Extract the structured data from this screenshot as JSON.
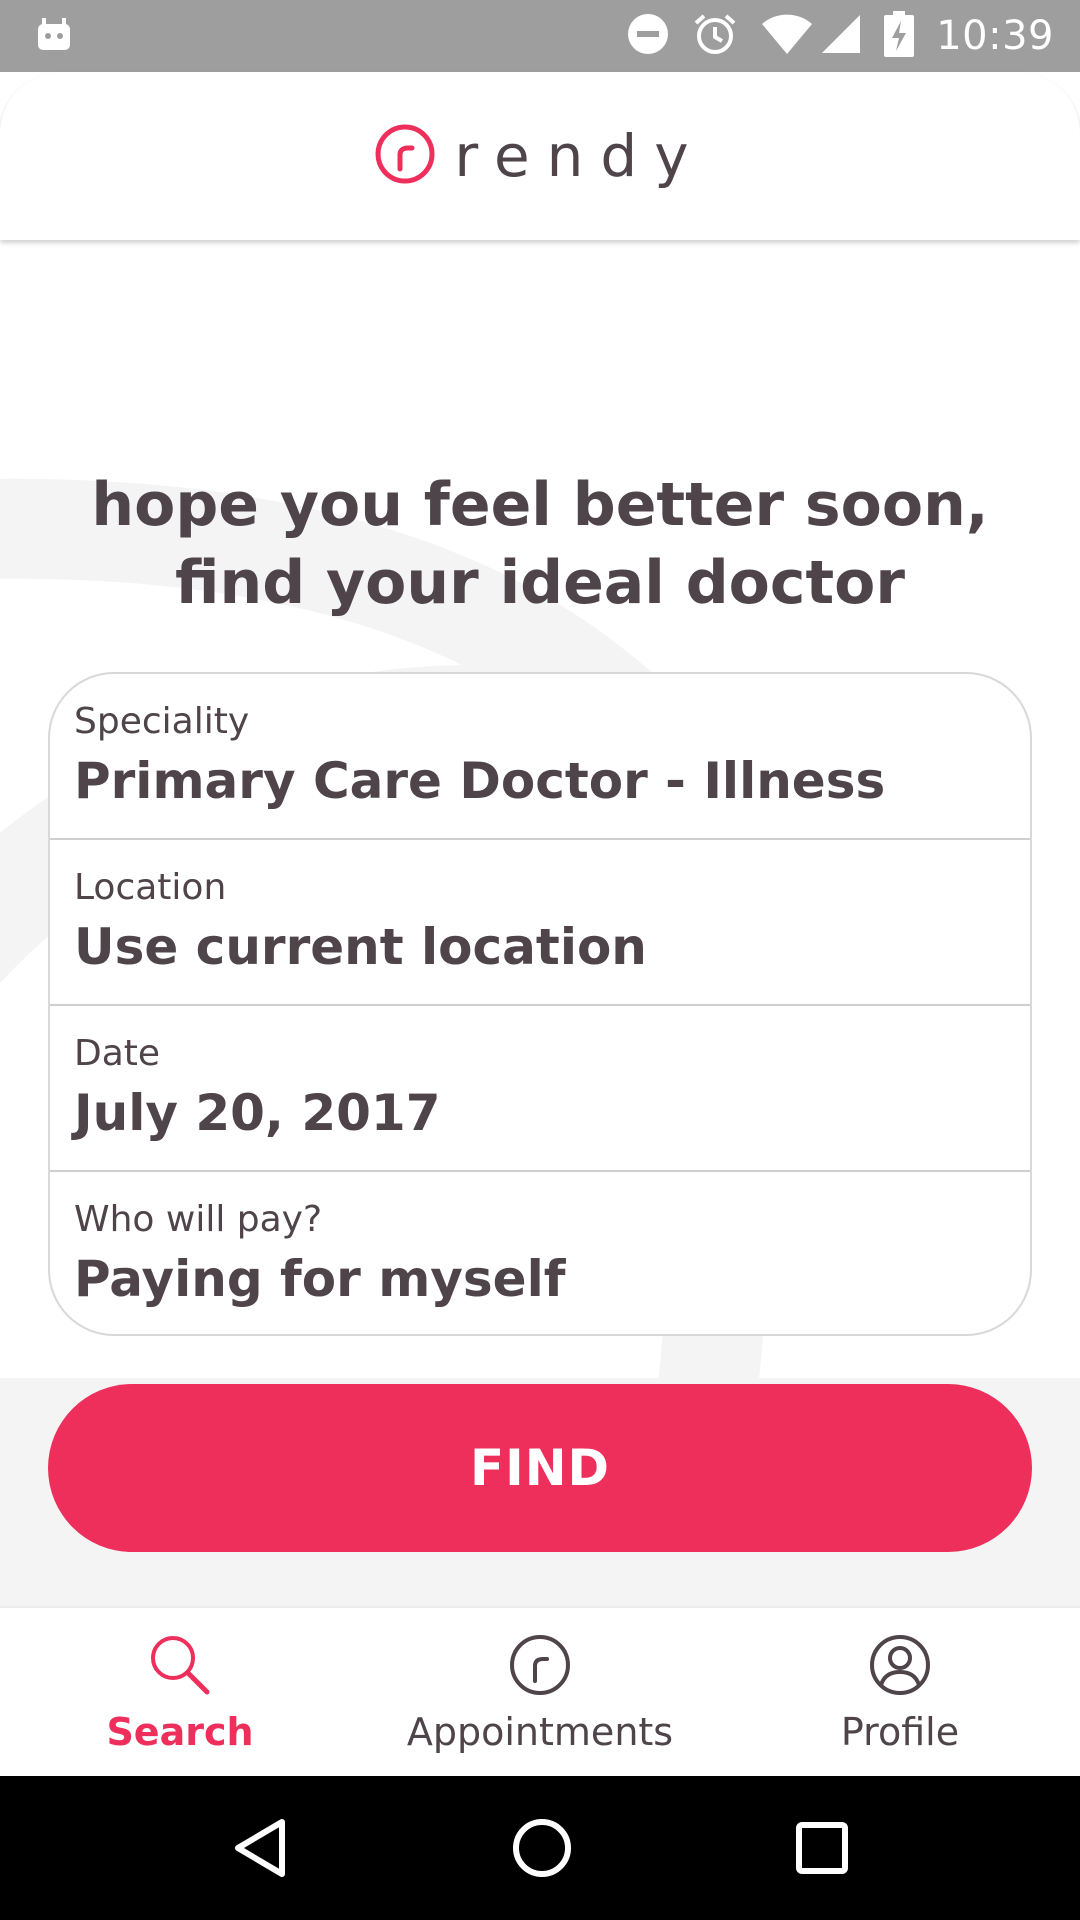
{
  "status_bar": {
    "time": "10:39",
    "icons": [
      "android-notification-icon",
      "do-not-disturb-icon",
      "alarm-icon",
      "wifi-icon",
      "cell-signal-icon",
      "battery-charging-icon"
    ]
  },
  "header": {
    "brand_name": "rendy",
    "logo_icon": "rendy-logo-icon"
  },
  "headline": "hope you feel better soon, find your ideal doctor",
  "form": {
    "fields": [
      {
        "label": "Speciality",
        "value": "Primary Care Doctor - Illness"
      },
      {
        "label": "Location",
        "value": "Use current location"
      },
      {
        "label": "Date",
        "value": "July 20, 2017"
      },
      {
        "label": "Who will pay?",
        "value": "Paying for myself"
      }
    ]
  },
  "find_button": {
    "label": "FIND"
  },
  "bottom_nav": {
    "items": [
      {
        "label": "Search",
        "icon": "search-icon",
        "active": true
      },
      {
        "label": "Appointments",
        "icon": "appointments-icon",
        "active": false
      },
      {
        "label": "Profile",
        "icon": "profile-icon",
        "active": false
      }
    ]
  },
  "android_nav": {
    "icons": [
      "back-icon",
      "home-icon",
      "recents-icon"
    ]
  },
  "colors": {
    "accent": "#ee2f5c",
    "text": "#4e4449",
    "status_bar": "#9e9e9e"
  }
}
